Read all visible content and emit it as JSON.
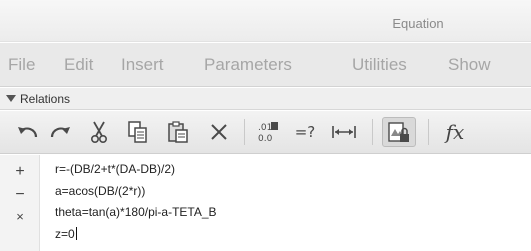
{
  "window": {
    "title": "Equation"
  },
  "menu": {
    "items": [
      {
        "label": "File"
      },
      {
        "label": "Edit"
      },
      {
        "label": "Insert"
      },
      {
        "label": "Parameters"
      },
      {
        "label": "Utilities"
      },
      {
        "label": "Show"
      }
    ]
  },
  "section": {
    "label": "Relations"
  },
  "toolbar": {
    "icons": [
      "undo-icon",
      "redo-icon",
      "cut-icon",
      "copy-icon",
      "paste-icon",
      "delete-icon",
      "decimal-places-icon",
      "evaluate-icon",
      "dimension-icon",
      "lock-icon",
      "function-icon"
    ],
    "evaluate_label": "=?",
    "function_label": "fx"
  },
  "gutter": {
    "add": "+",
    "remove": "−",
    "close": "×"
  },
  "editor": {
    "lines": [
      "r=-(DB/2+t*(DA-DB)/2)",
      "a=acos(DB/(2*r))",
      "theta=tan(a)*180/pi-a-TETA_B",
      "z=0"
    ]
  }
}
